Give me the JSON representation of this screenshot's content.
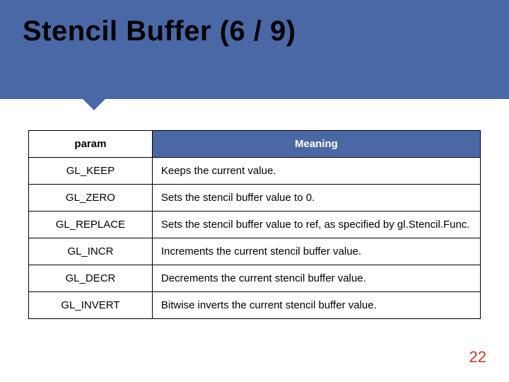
{
  "title": "Stencil Buffer (6 / 9)",
  "columns": {
    "param": "param",
    "meaning": "Meaning"
  },
  "rows": [
    {
      "param": "GL_KEEP",
      "meaning": "Keeps the current value."
    },
    {
      "param": "GL_ZERO",
      "meaning": "Sets the stencil buffer value to 0."
    },
    {
      "param": "GL_REPLACE",
      "meaning": "Sets the stencil buffer value to ref, as specified by gl.Stencil.Func."
    },
    {
      "param": "GL_INCR",
      "meaning": "Increments the current stencil buffer value."
    },
    {
      "param": "GL_DECR",
      "meaning": "Decrements the current stencil buffer value."
    },
    {
      "param": "GL_INVERT",
      "meaning": "Bitwise inverts the current stencil buffer value."
    }
  ],
  "page_number": "22"
}
